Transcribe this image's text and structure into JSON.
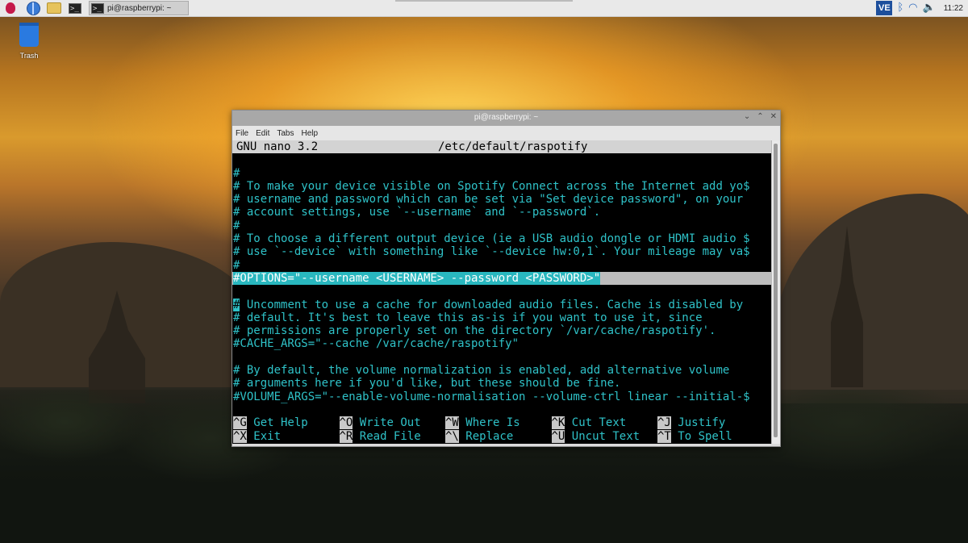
{
  "panel": {
    "task_label": "pi@raspberrypi: ~",
    "clock": "11:22",
    "ve_label": "VE"
  },
  "desktop": {
    "trash_label": "Trash"
  },
  "window": {
    "title": "pi@raspberrypi: ~",
    "menu": [
      "File",
      "Edit",
      "Tabs",
      "Help"
    ]
  },
  "nano": {
    "app": "GNU nano 3.2",
    "file": "/etc/default/raspotify",
    "lines": [
      "",
      "#",
      "# To make your device visible on Spotify Connect across the Internet add yo$",
      "# username and password which can be set via \"Set device password\", on your",
      "# account settings, use `--username` and `--password`.",
      "#",
      "# To choose a different output device (ie a USB audio dongle or HDMI audio $",
      "# use `--device` with something like `--device hw:0,1`. Your mileage may va$",
      "#"
    ],
    "options_line": "#OPTIONS=\"--username <USERNAME> --password <PASSWORD>\"",
    "blank_after_options": "",
    "cursor_char": "#",
    "cache_first_rest": " Uncomment to use a cache for downloaded audio files. Cache is disabled by",
    "lines2": [
      "# default. It's best to leave this as-is if you want to use it, since",
      "# permissions are properly set on the directory `/var/cache/raspotify'.",
      "#CACHE_ARGS=\"--cache /var/cache/raspotify\"",
      "",
      "# By default, the volume normalization is enabled, add alternative volume",
      "# arguments here if you'd like, but these should be fine.",
      "#VOLUME_ARGS=\"--enable-volume-normalisation --volume-ctrl linear --initial-$",
      ""
    ],
    "shortcuts_row1": [
      {
        "key": "^G",
        "label": " Get Help"
      },
      {
        "key": "^O",
        "label": " Write Out"
      },
      {
        "key": "^W",
        "label": " Where Is"
      },
      {
        "key": "^K",
        "label": " Cut Text"
      },
      {
        "key": "^J",
        "label": " Justify"
      }
    ],
    "shortcuts_row2": [
      {
        "key": "^X",
        "label": " Exit"
      },
      {
        "key": "^R",
        "label": " Read File"
      },
      {
        "key": "^\\",
        "label": " Replace"
      },
      {
        "key": "^U",
        "label": " Uncut Text"
      },
      {
        "key": "^T",
        "label": " To Spell"
      }
    ]
  }
}
